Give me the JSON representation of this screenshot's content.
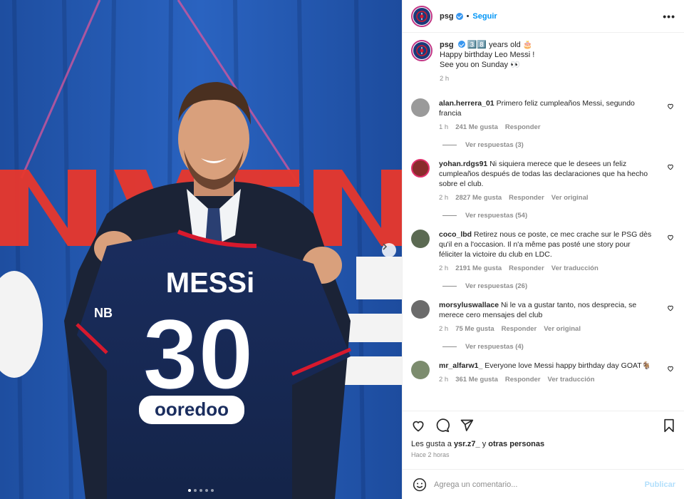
{
  "post": {
    "image_alt": "",
    "slides": 5,
    "active_slide": 1
  },
  "header": {
    "username": "psg",
    "bullet": "•",
    "follow_label": "Seguir",
    "more_label": "•••"
  },
  "caption": {
    "username": "psg",
    "line1": "3️⃣8️⃣ years old 🎂",
    "line2": "Happy birthday Leo Messi !",
    "line3": "See you on Sunday 👀",
    "time": "2 h"
  },
  "comments": [
    {
      "username": "alan.herrera_01",
      "text": "Primero feliz cumpleaños Messi, segundo francia",
      "time": "1 h",
      "likes": "241 Me gusta",
      "reply": "Responder",
      "extra": "",
      "replies": "Ver respuestas (3)",
      "avatar_color": "#9a9a9a"
    },
    {
      "username": "yohan.rdgs91",
      "text": "Ni siquiera merece que le desees un feliz cumpleaños después de todas las declaraciones que ha hecho sobre el club.",
      "time": "2 h",
      "likes": "2827 Me gusta",
      "reply": "Responder",
      "extra": "Ver original",
      "replies": "Ver respuestas (54)",
      "avatar_color": "#8a2c2c"
    },
    {
      "username": "coco_lbd",
      "text": "Retirez nous ce poste, ce mec crache sur le PSG dès qu'il en a l'occasion. Il n'a même pas posté une story pour féliciter la victoire du club en LDC.",
      "time": "2 h",
      "likes": "2191 Me gusta",
      "reply": "Responder",
      "extra": "Ver traducción",
      "replies": "Ver respuestas (26)",
      "avatar_color": "#5b6a52"
    },
    {
      "username": "morsyluswallace",
      "text": "Ni le va a gustar tanto, nos desprecia, se merece cero mensajes del club",
      "time": "2 h",
      "likes": "75 Me gusta",
      "reply": "Responder",
      "extra": "Ver original",
      "replies": "Ver respuestas (4)",
      "avatar_color": "#6b6b6b"
    },
    {
      "username": "mr_alfarw1_",
      "text": "Everyone love Messi happy birthday day GOAT🐐",
      "time": "2 h",
      "likes": "361 Me gusta",
      "reply": "Responder",
      "extra": "Ver traducción",
      "replies": "",
      "avatar_color": "#7c8c6e"
    }
  ],
  "footer": {
    "likes_prefix": "Les gusta a ",
    "likes_user": "ysr.z7_",
    "likes_mid": " y ",
    "likes_others": "otras personas",
    "time": "Hace 2 horas",
    "comment_placeholder": "Agrega un comentario...",
    "publish_label": "Publicar"
  },
  "colors": {
    "accent": "#0095f6",
    "psg_navy": "#1b3a7a",
    "psg_red": "#d7192d"
  },
  "jersey": {
    "name": "MESSi",
    "number": "30",
    "sponsor": "ooredoo"
  }
}
